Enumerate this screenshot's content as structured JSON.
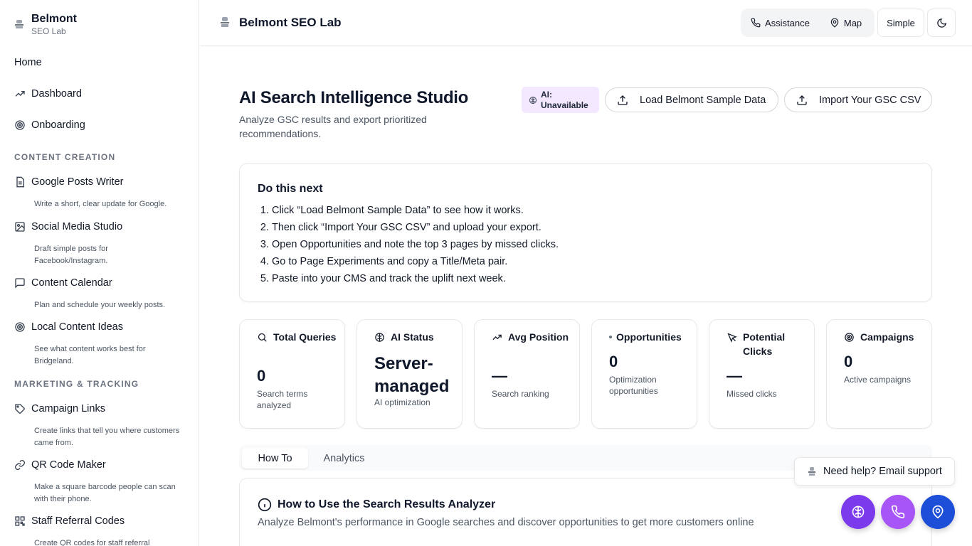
{
  "brand": {
    "name": "Belmont",
    "sub": "SEO Lab"
  },
  "sidebar": {
    "top_items": [
      {
        "label": "Home",
        "icon": "none"
      },
      {
        "label": "Dashboard",
        "icon": "trending-up-icon"
      },
      {
        "label": "Onboarding",
        "icon": "target-icon"
      }
    ],
    "sections": [
      {
        "title": "CONTENT CREATION",
        "items": [
          {
            "label": "Google Posts Writer",
            "desc": "Write a short, clear update for Google.",
            "icon": "file-text-icon"
          },
          {
            "label": "Social Media Studio",
            "desc": "Draft simple posts for Facebook/Instagram.",
            "icon": "image-icon"
          },
          {
            "label": "Content Calendar",
            "desc": "Plan and schedule your weekly posts.",
            "icon": "message-square-icon"
          },
          {
            "label": "Local Content Ideas",
            "desc": "See what content works best for Bridgeland.",
            "icon": "target-icon"
          }
        ]
      },
      {
        "title": "MARKETING & TRACKING",
        "items": [
          {
            "label": "Campaign Links",
            "desc": "Create links that tell you where customers came from.",
            "icon": "tag-icon"
          },
          {
            "label": "QR Code Maker",
            "desc": "Make a square barcode people can scan with their phone.",
            "icon": "link-icon"
          },
          {
            "label": "Staff Referral Codes",
            "desc": "Create QR codes for staff referral",
            "icon": "qr-code-icon"
          }
        ]
      }
    ]
  },
  "header": {
    "title": "Belmont SEO Lab",
    "assistance_label": "Assistance",
    "map_label": "Map",
    "simple_label": "Simple",
    "theme_icon": "moon-icon"
  },
  "main": {
    "title": "AI Search Intelligence Studio",
    "subtitle": "Analyze GSC results and export prioritized recommendations.",
    "ai_badge_line1": "AI:",
    "ai_badge_line2": "Unavailable",
    "load_sample_label": "Load Belmont Sample Data",
    "import_label": "Import Your GSC CSV",
    "next_title": "Do this next",
    "next_steps": [
      "Click “Load Belmont Sample Data” to see how it works.",
      "Then click “Import Your GSC CSV” and upload your export.",
      "Open Opportunities and note the top 3 pages by missed clicks.",
      "Go to Page Experiments and copy a Title/Meta pair.",
      "Paste into your CMS and track the uplift next week."
    ],
    "stats": [
      {
        "label": "Total Queries",
        "value": "0",
        "sub": "Search terms analyzed",
        "icon": "search-icon"
      },
      {
        "label": "AI Status",
        "value": "Server-managed",
        "sub": "AI optimization",
        "icon": "brain-icon"
      },
      {
        "label": "Avg Position",
        "value": "—",
        "sub": "Search ranking",
        "icon": "trending-up-icon"
      },
      {
        "label": "Opportunities",
        "value": "0",
        "sub": "Optimization opportunities",
        "icon": "dot-icon"
      },
      {
        "label": "Potential Clicks",
        "value": "—",
        "sub": "Missed clicks",
        "icon": "cursor-icon"
      },
      {
        "label": "Campaigns",
        "value": "0",
        "sub": "Active campaigns",
        "icon": "target-icon"
      }
    ],
    "tabs": [
      {
        "label": "How To",
        "active": true
      },
      {
        "label": "Analytics",
        "active": false
      }
    ],
    "how_title": "How to Use the Search Results Analyzer",
    "how_desc": "Analyze Belmont's performance in Google searches and discover opportunities to get more customers online"
  },
  "support": {
    "label": "Need help? Email support"
  },
  "fabs": [
    {
      "icon": "brain-icon",
      "color": "#7c3aed"
    },
    {
      "icon": "phone-icon",
      "color": "#a855f7"
    },
    {
      "icon": "map-pin-icon",
      "color": "#1d4ed8"
    }
  ],
  "colors": {
    "accent_purple": "#7c3aed",
    "badge_bg": "#f3e8ff",
    "primary_blue": "#1d4ed8"
  }
}
